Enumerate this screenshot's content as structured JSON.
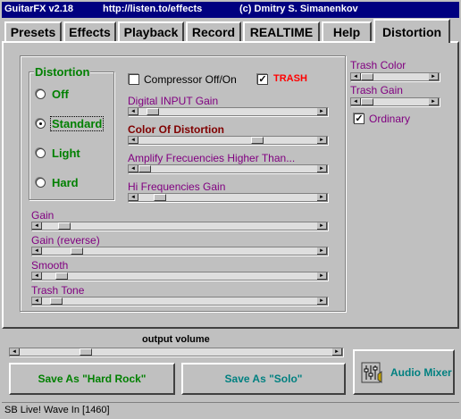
{
  "title": {
    "app": "GuitarFX v2.18",
    "url": "http://listen.to/effects",
    "credit": "(c) Dmitry S. Simanenkov"
  },
  "tabs": [
    {
      "label": "Presets"
    },
    {
      "label": "Effects"
    },
    {
      "label": "Playback"
    },
    {
      "label": "Record"
    },
    {
      "label": "REALTIME"
    },
    {
      "label": "Help"
    },
    {
      "label": "Distortion",
      "active": true
    }
  ],
  "distortion_group": {
    "legend": "Distortion",
    "options": [
      {
        "label": "Off",
        "checked": false
      },
      {
        "label": "Standard",
        "checked": true
      },
      {
        "label": "Light",
        "checked": false
      },
      {
        "label": "Hard",
        "checked": false
      }
    ]
  },
  "checks": {
    "compressor": {
      "label": "Compressor Off/On",
      "checked": false
    },
    "trash": {
      "label": "TRASH",
      "checked": true
    },
    "ordinary": {
      "label": "Ordinary",
      "checked": true
    }
  },
  "sliders": {
    "digital_input_gain": {
      "label": "Digital INPUT Gain",
      "level": 0.05
    },
    "color_of_distortion": {
      "label": "Color Of Distortion",
      "level": 0.68
    },
    "amplify_freq": {
      "label": "Amplify Frecuencies Higher Than...",
      "level": 0.0
    },
    "hi_freq_gain": {
      "label": "Hi Frequencies Gain",
      "level": 0.09
    },
    "gain": {
      "label": "Gain",
      "level": 0.06
    },
    "gain_reverse": {
      "label": "Gain (reverse)",
      "level": 0.11
    },
    "smooth": {
      "label": "Smooth",
      "level": 0.05
    },
    "trash_tone": {
      "label": "Trash Tone",
      "level": 0.03
    },
    "trash_color": {
      "label": "Trash Color",
      "level": 0.0
    },
    "trash_gain": {
      "label": "Trash Gain",
      "level": 0.0
    },
    "output_volume": {
      "label": "output volume",
      "level": 0.2
    }
  },
  "buttons": {
    "save_hard_rock": "Save As \"Hard Rock\"",
    "save_solo": "Save As \"Solo\"",
    "audio_mixer": "Audio Mixer"
  },
  "status": "SB Live! Wave In [1460]",
  "colors": {
    "title_bar": "#000080",
    "face": "#c0c0c0",
    "green": "#008000",
    "purple": "#800080",
    "dark_red": "#800000",
    "red": "#ff0000",
    "teal": "#008080"
  }
}
